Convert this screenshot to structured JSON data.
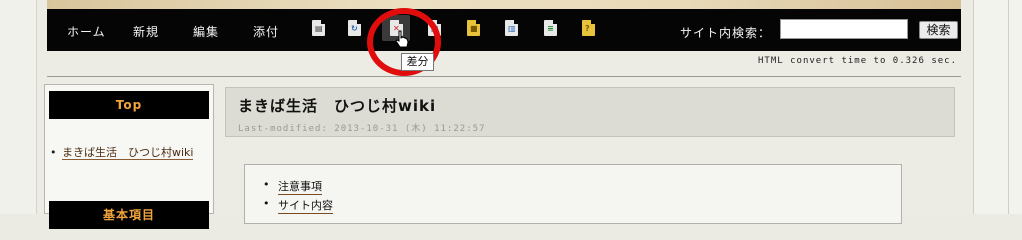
{
  "nav": {
    "links": [
      "ホーム",
      "新規",
      "編集",
      "添付"
    ],
    "search_label": "サイト内検索：",
    "search_value": "",
    "search_button": "検索"
  },
  "tooltip": "差分",
  "convert_time": "HTML convert time to 0.326 sec.",
  "sidebar": {
    "top_heading": "Top",
    "items": [
      "まきば生活　ひつじ村wiki"
    ],
    "next_heading": "基本項目"
  },
  "content": {
    "title": "まきば生活　ひつじ村wiki",
    "last_modified": "Last-modified: 2013-10-31 (木) 11:22:57",
    "toc": [
      "注意事項",
      "サイト内容"
    ]
  },
  "icons": [
    "copy-icon",
    "rename-icon",
    "diff-icon",
    "backup-icon",
    "freeze-icon",
    "duplicate-icon",
    "list-icon",
    "source-icon"
  ],
  "colors": {
    "navbar": "#050505",
    "sidebar_heading_text": "#f0a43d",
    "highlight_circle": "#e10d0d"
  }
}
